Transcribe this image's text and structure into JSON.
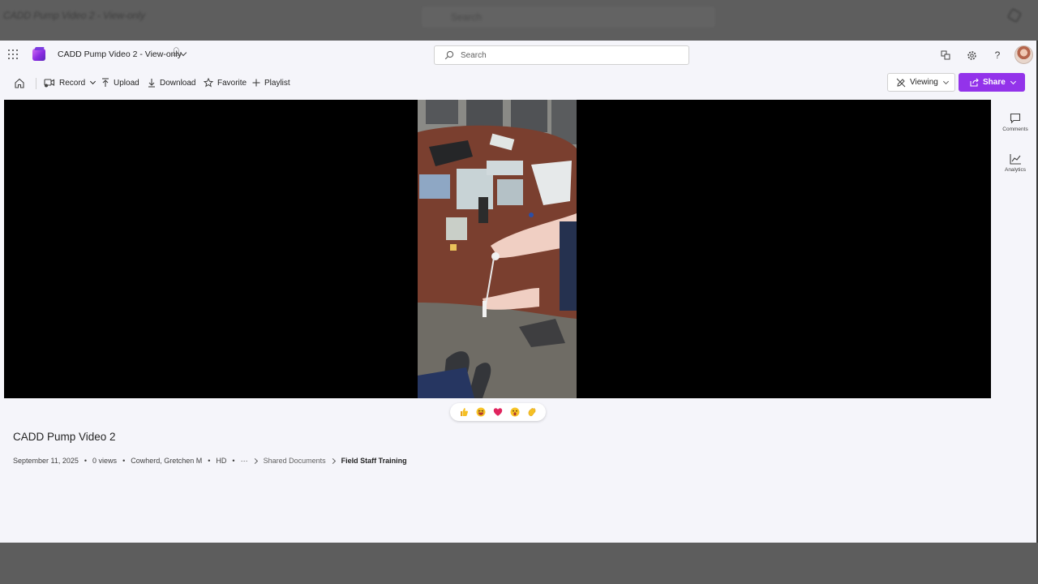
{
  "ghost": {
    "title": "CADD Pump Video 2 - View-only",
    "search": "Search"
  },
  "header": {
    "doc_title": "CADD Pump Video 2 - View-only",
    "search_placeholder": "Search"
  },
  "toolbar": {
    "record_label": "Record",
    "upload_label": "Upload",
    "download_label": "Download",
    "favorite_label": "Favorite",
    "playlist_label": "Playlist",
    "viewing_label": "Viewing",
    "share_label": "Share"
  },
  "rail": {
    "comments_label": "Comments",
    "analytics_label": "Analytics"
  },
  "reactions": [
    "thumbs-up",
    "laugh",
    "heart",
    "surprised",
    "clap"
  ],
  "video_info": {
    "title": "CADD Pump Video 2",
    "date": "September 11, 2025",
    "views": "0 views",
    "owner": "Cowherd, Gretchen M",
    "quality": "HD",
    "more": "···",
    "breadcrumb_parent": "Shared Documents",
    "breadcrumb_current": "Field Staff Training"
  },
  "colors": {
    "accent": "#9333ea",
    "app_background": "#f5f5fa",
    "video_background": "#000000",
    "outer_background": "#5d5d5d"
  }
}
